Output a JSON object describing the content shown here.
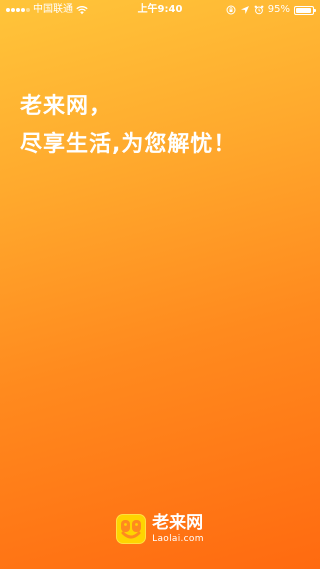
{
  "status_bar": {
    "carrier": "中国联通",
    "time": "上午9:40",
    "battery_text": "95%",
    "battery_level": 0.95,
    "icons": [
      "signal-icon",
      "wifi-icon",
      "orientation-lock-icon",
      "location-icon",
      "alarm-icon",
      "battery-icon"
    ]
  },
  "slogan": {
    "line1": "老来网，",
    "line2": "尽享生活,为您解忧！"
  },
  "logo": {
    "name_cn": "老来网",
    "name_en": "Laolai.com"
  },
  "colors": {
    "gradient_top": "#ffc53a",
    "gradient_bottom": "#ff6a10",
    "logo_yellow": "#ffd400",
    "text": "#ffffff"
  }
}
